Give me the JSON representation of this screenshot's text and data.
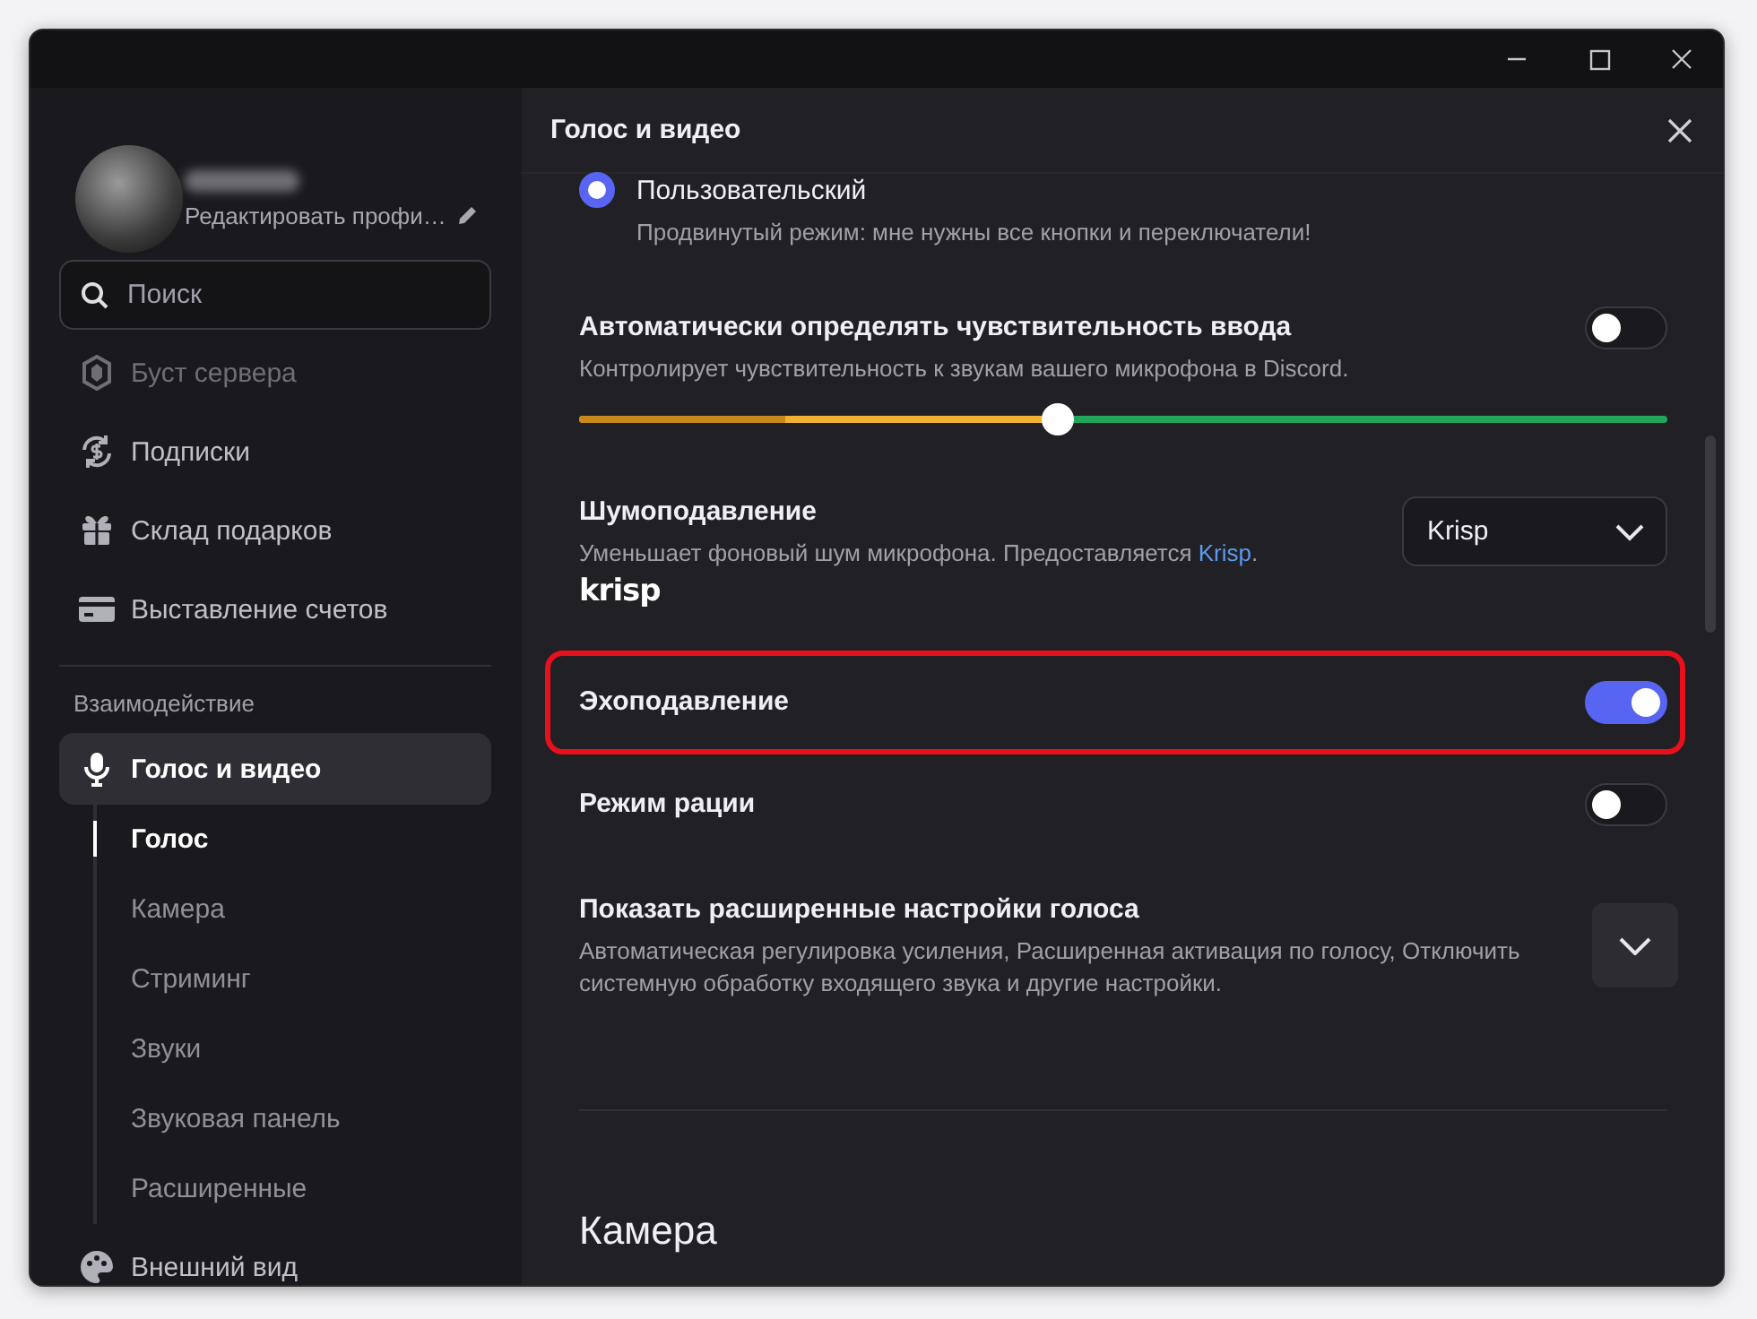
{
  "sidebar": {
    "profile": {
      "edit_label": "Редактировать профи…"
    },
    "search": {
      "placeholder": "Поиск"
    },
    "billing_items": [
      {
        "label": "Буст сервера",
        "disabled": true
      },
      {
        "label": "Подписки",
        "disabled": false
      },
      {
        "label": "Склад подарков",
        "disabled": false
      },
      {
        "label": "Выставление счетов",
        "disabled": false
      }
    ],
    "section_header": "Взаимодействие",
    "app_items": [
      {
        "label": "Голос и видео",
        "selected": true,
        "expanded": true,
        "children": [
          {
            "label": "Голос",
            "selected": true
          },
          {
            "label": "Камера",
            "selected": false
          },
          {
            "label": "Стриминг",
            "selected": false
          },
          {
            "label": "Звуки",
            "selected": false
          },
          {
            "label": "Звуковая панель",
            "selected": false
          },
          {
            "label": "Расширенные",
            "selected": false
          }
        ]
      },
      {
        "label": "Внешний вид",
        "selected": false,
        "expanded": false
      }
    ]
  },
  "content": {
    "title": "Голос и видео",
    "settings": [
      {
        "kind": "radio",
        "label": "Пользовательский",
        "description": "Продвинутый режим: мне нужны все кнопки и переключатели!",
        "checked": true
      },
      {
        "kind": "toggle",
        "label": "Автоматически определять чувствительность ввода",
        "description": "Контролирует чувствительность к звукам вашего микрофона в Discord.",
        "on": false,
        "highlighted": false,
        "slider": {
          "level": 0.44,
          "meter": {
            "level": 0.19
          }
        }
      },
      {
        "kind": "dropdown",
        "label": "Шумоподавление",
        "description": "Уменьшает фоновый шум микрофона. Предоставляется ",
        "link": "Krisp",
        "description_end": ".",
        "logo_text": "krisp",
        "value": "Krisp"
      },
      {
        "kind": "toggle",
        "label": "Эхоподавление",
        "on": true,
        "highlighted": true
      },
      {
        "kind": "toggle",
        "label": "Режим рации",
        "on": false,
        "highlighted": false
      },
      {
        "kind": "expand",
        "label": "Показать расширенные настройки голоса",
        "description": "Автоматическая регулировка усиления, Расширенная активация по голосу, Отключить системную обработку входящего звука и другие настройки.",
        "expanded": false
      }
    ],
    "next_section": "Камера"
  }
}
